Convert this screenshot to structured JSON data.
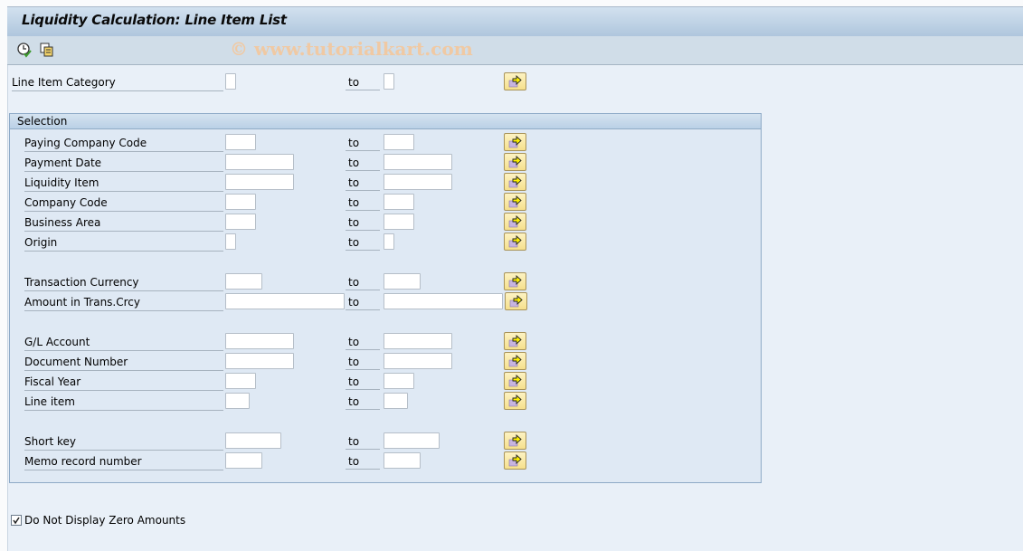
{
  "window": {
    "title": "Liquidity Calculation: Line Item List",
    "watermark": "© www.tutorialkart.com"
  },
  "toolbar": {
    "icons": [
      "execute-clock-icon",
      "get-variant-icon"
    ]
  },
  "top_field": {
    "label": "Line Item Category",
    "to_label": "to"
  },
  "selection": {
    "title": "Selection",
    "rows": [
      {
        "label": "Paying Company Code",
        "to_label": "to"
      },
      {
        "label": "Payment Date",
        "to_label": "to"
      },
      {
        "label": "Liquidity Item",
        "to_label": "to"
      },
      {
        "label": "Company Code",
        "to_label": "to"
      },
      {
        "label": "Business Area",
        "to_label": "to"
      },
      {
        "label": "Origin",
        "to_label": "to"
      },
      {
        "label": "Transaction Currency",
        "to_label": "to"
      },
      {
        "label": "Amount in Trans.Crcy",
        "to_label": "to"
      },
      {
        "label": "G/L Account",
        "to_label": "to"
      },
      {
        "label": "Document Number",
        "to_label": "to"
      },
      {
        "label": "Fiscal Year",
        "to_label": "to"
      },
      {
        "label": "Line item",
        "to_label": "to"
      },
      {
        "label": "Short key",
        "to_label": "to"
      },
      {
        "label": "Memo record number",
        "to_label": "to"
      }
    ]
  },
  "options": {
    "zero_amounts": {
      "label": "Do Not Display Zero Amounts",
      "checked": true
    }
  }
}
